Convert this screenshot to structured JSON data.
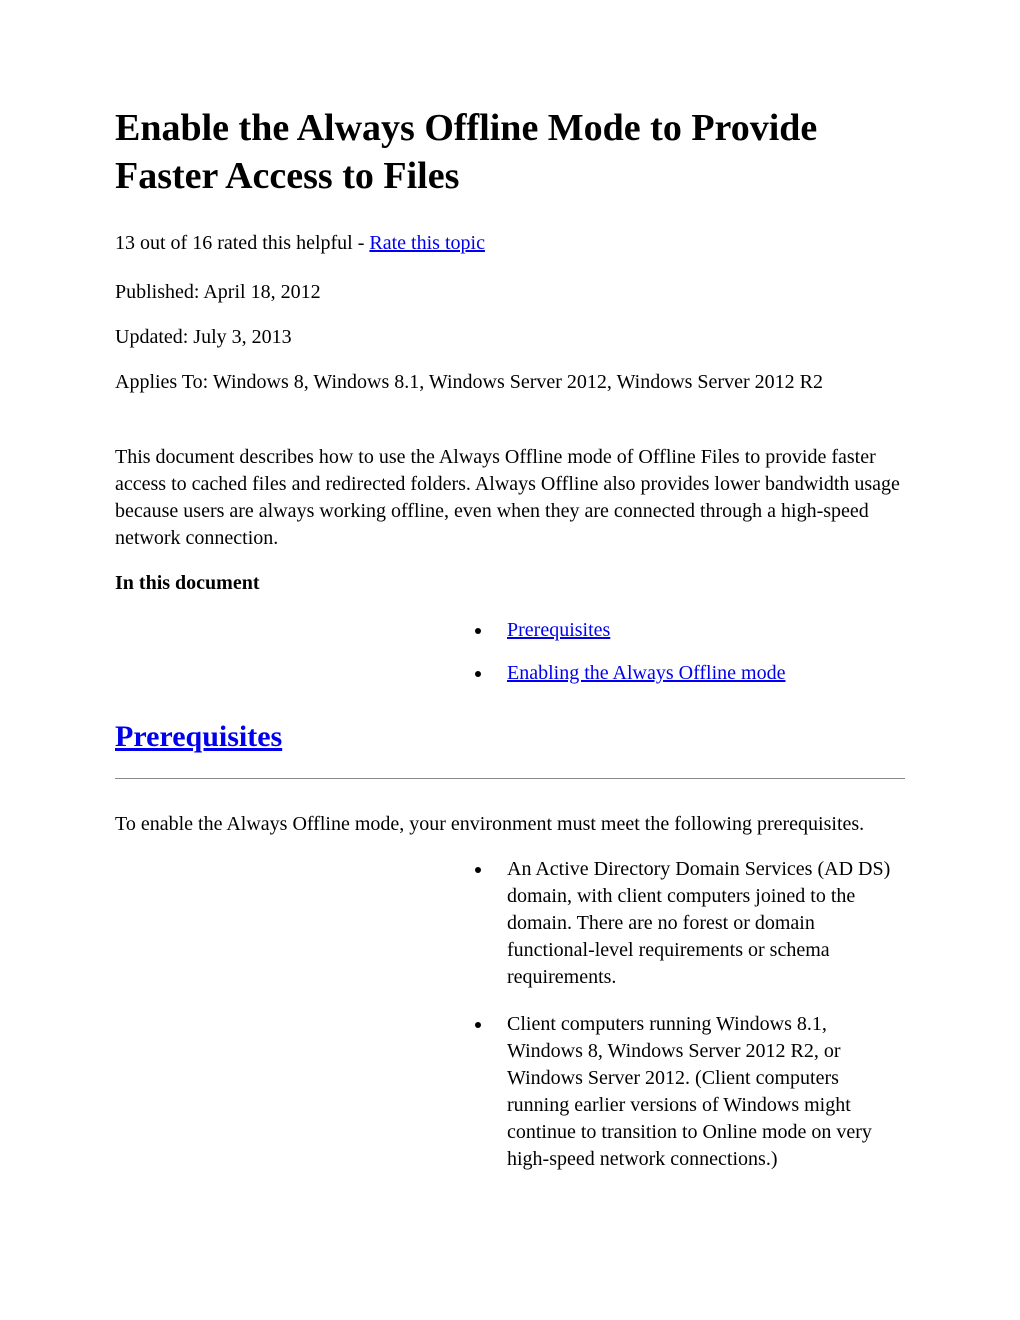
{
  "title": "Enable the Always Offline Mode to Provide Faster Access to Files",
  "rating": {
    "text": "13 out of 16 rated this helpful - ",
    "link": "Rate this topic"
  },
  "published": "Published: April 18, 2012",
  "updated": "Updated: July 3, 2013",
  "appliesTo": "Applies To: Windows 8, Windows 8.1, Windows Server 2012, Windows Server 2012 R2",
  "intro": "This document describes how to use the Always Offline mode of Offline Files to provide faster access to cached files and redirected folders. Always Offline also provides lower bandwidth usage because users are always working offline, even when they are connected through a high-speed network connection.",
  "inThisDoc": "In this document",
  "toc": [
    "Prerequisites",
    "Enabling the Always Offline mode"
  ],
  "sectionHeading": "Prerequisites",
  "prereqIntro": "To enable the Always Offline mode, your environment must meet the following prerequisites.",
  "prereqItems": [
    "An Active Directory Domain Services (AD DS) domain, with client computers joined to the domain. There are no forest or domain functional-level requirements or schema requirements.",
    "Client computers running Windows 8.1, Windows 8, Windows Server 2012 R2, or Windows Server 2012. (Client computers running earlier versions of Windows might continue to transition to Online mode on very high-speed network connections.)"
  ]
}
